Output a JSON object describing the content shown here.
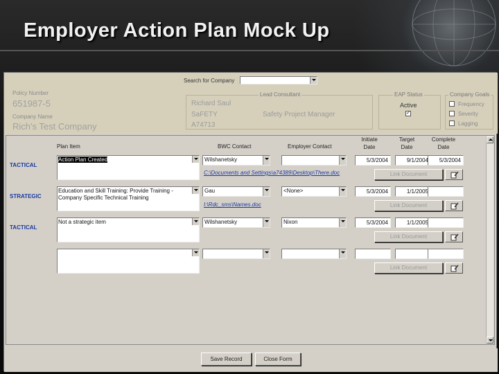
{
  "slide": {
    "title": "Employer Action Plan Mock Up"
  },
  "header": {
    "policy_number_label": "Policy Number",
    "policy_number": "651987-5",
    "company_name_label": "Company Name",
    "company_name": "Rich's Test Company",
    "search_label": "Search for Company",
    "lead_consultant": {
      "title": "Lead Consultant",
      "name": "Richard Saul",
      "department": "SaFETY",
      "id": "A74713",
      "role": "Safety Project Manager"
    },
    "eap_status": {
      "title": "EAP Status",
      "value": "Active",
      "checked": true
    },
    "company_goals": {
      "title": "Company Goals",
      "items": [
        {
          "label": "Frequency",
          "checked": false
        },
        {
          "label": "Severity",
          "checked": false
        },
        {
          "label": "Lagging",
          "checked": false
        }
      ]
    }
  },
  "columns": {
    "plan_item": "Plan Item",
    "bwc_contact": "BWC Contact",
    "employer_contact": "Employer Contact",
    "initiate_date": "Initiate Date",
    "target_date": "Target Date",
    "complete_date": "Complete Date"
  },
  "rows": [
    {
      "type": "TACTICAL",
      "plan_item": "Action Plan Created",
      "bwc_contact": "Wilshanetsky",
      "employer_contact": "",
      "initiate": "5/3/2004",
      "target": "9/1/2004",
      "complete": "5/3/2004",
      "link": "C:\\Documents and Settings\\a74389\\Desktop\\There.doc",
      "link_button": "Link Document"
    },
    {
      "type": "STRATEGIC",
      "plan_item": "Education and Skill Training: Provide Training - Company Specific Technical Training",
      "bwc_contact": "Gau",
      "employer_contact": "<None>",
      "initiate": "5/3/2004",
      "target": "1/1/2005",
      "complete": "",
      "link": "I:\\Rdc_sms\\Names.doc",
      "link_button": "Link Document"
    },
    {
      "type": "TACTICAL",
      "plan_item": "Not a strategic item",
      "bwc_contact": "Wilshanetsky",
      "employer_contact": "Nixon",
      "initiate": "5/3/2004",
      "target": "1/1/2005",
      "complete": "",
      "link": "",
      "link_button": "Link Document"
    },
    {
      "type": "",
      "plan_item": "",
      "bwc_contact": "",
      "employer_contact": "",
      "initiate": "",
      "target": "",
      "complete": "",
      "link": "",
      "link_button": "Link Document"
    }
  ],
  "footer": {
    "save": "Save Record",
    "close": "Close Form"
  }
}
